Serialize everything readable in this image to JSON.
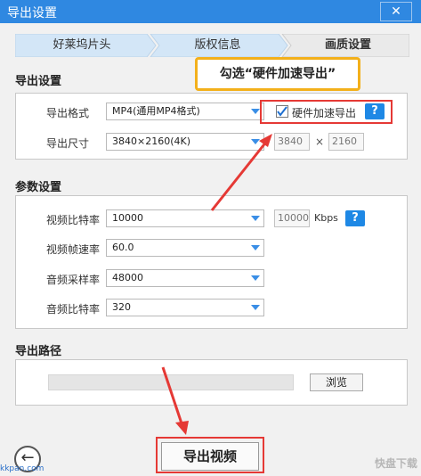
{
  "window": {
    "title": "导出设置",
    "close_glyph": "✕"
  },
  "steps": [
    "好莱坞片头",
    "版权信息",
    "画质设置"
  ],
  "export_settings": {
    "section_title": "导出设置",
    "format_label": "导出格式",
    "format_value": "MP4(通用MP4格式)",
    "hw_accel_label": "硬件加速导出",
    "hw_accel_checked": true,
    "help": "?",
    "size_label": "导出尺寸",
    "size_value": "3840×2160(4K)",
    "width": "3840",
    "times": "×",
    "height": "2160"
  },
  "callout": {
    "text": "勾选“硬件加速导出”"
  },
  "params": {
    "section_title": "参数设置",
    "video_bitrate_label": "视频比特率",
    "video_bitrate_value": "10000",
    "bitrate_box": "10000",
    "bitrate_unit": "Kbps",
    "help": "?",
    "frame_rate_label": "视频帧速率",
    "frame_rate_value": "60.0",
    "sample_rate_label": "音频采样率",
    "sample_rate_value": "48000",
    "audio_bitrate_label": "音频比特率",
    "audio_bitrate_value": "320"
  },
  "path": {
    "section_title": "导出路径",
    "value": "",
    "browse_label": "浏览"
  },
  "actions": {
    "export_label": "导出视频",
    "back_glyph": "←"
  },
  "watermarks": {
    "left": "kkpan.com",
    "right": "快盘下载"
  },
  "colors": {
    "titlebar": "#2f88e1",
    "accent": "#1e88e5",
    "annotation_red": "#e53935",
    "callout_border": "#f3b01b"
  }
}
